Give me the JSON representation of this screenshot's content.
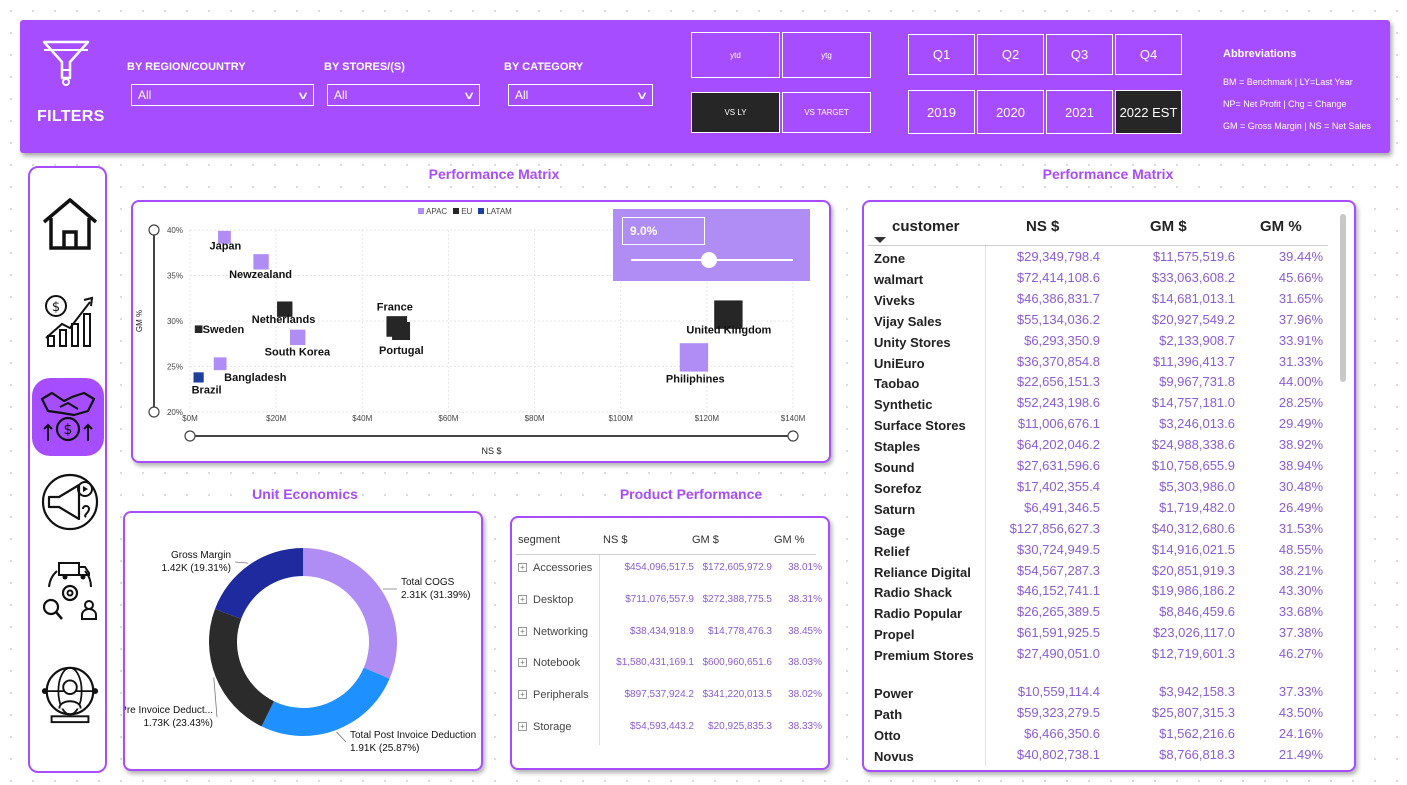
{
  "filters": {
    "title": "FILTERS",
    "dropdowns": [
      {
        "label": "BY REGION/COUNTRY",
        "value": "All"
      },
      {
        "label": "BY STORES/(S)",
        "value": "All"
      },
      {
        "label": "BY CATEGORY",
        "value": "All"
      }
    ],
    "period_buttons": [
      "ytd",
      "ytg",
      "VS LY",
      "VS TARGET"
    ],
    "quarters": [
      "Q1",
      "Q2",
      "Q3",
      "Q4"
    ],
    "years": [
      "2019",
      "2020",
      "2021",
      "2022 EST"
    ],
    "abbreviations": {
      "title": "Abbreviations",
      "lines": [
        "BM = Benchmark | LY=Last Year",
        "NP= Net Profit | Chg = Change",
        "GM = Gross Margin | NS = Net Sales"
      ]
    }
  },
  "sidebar": {
    "items": [
      {
        "icon": "home-icon"
      },
      {
        "icon": "finance-growth-icon"
      },
      {
        "icon": "handshake-money-icon",
        "active": true
      },
      {
        "icon": "marketing-megaphone-icon"
      },
      {
        "icon": "supply-chain-truck-icon"
      },
      {
        "icon": "global-person-icon"
      }
    ]
  },
  "performance_scatter": {
    "title": "Performance Matrix",
    "legend": [
      "APAC",
      "EU",
      "LATAM"
    ],
    "slider_value": "9.0%",
    "slider_fraction": 0.12,
    "colors": {
      "APAC": "#b08cf5",
      "EU": "#262626",
      "LATAM": "#1f3f9e"
    }
  },
  "chart_data": [
    {
      "type": "scatter",
      "title": "Performance Matrix",
      "xlabel": "NS $",
      "ylabel": "GM %",
      "xlim": [
        0,
        140
      ],
      "ylim": [
        20,
        40
      ],
      "x_ticks": [
        "$0M",
        "$20M",
        "$40M",
        "$60M",
        "$80M",
        "$100M",
        "$120M",
        "$140M"
      ],
      "y_ticks": [
        "40%",
        "35%",
        "30%",
        "25%",
        "20%"
      ],
      "legend": "top-center",
      "grid": true,
      "series": [
        {
          "name": "APAC",
          "points": [
            {
              "label": "Japan",
              "x": 8,
              "y": 39.2,
              "size": 3
            },
            {
              "label": "Newzealand",
              "x": 16.5,
              "y": 36.5,
              "size": 4
            },
            {
              "label": "South Korea",
              "x": 25,
              "y": 28.2,
              "size": 4
            },
            {
              "label": "Bangladesh",
              "x": 7,
              "y": 25.3,
              "size": 3
            },
            {
              "label": "Philiphines",
              "x": 117,
              "y": 26.0,
              "size": 9
            }
          ]
        },
        {
          "name": "EU",
          "points": [
            {
              "label": "Netherlands",
              "x": 22,
              "y": 31.3,
              "size": 4
            },
            {
              "label": "Sweden",
              "x": 2,
              "y": 29.1,
              "size": 1
            },
            {
              "label": "France",
              "x": 48,
              "y": 29.4,
              "size": 6
            },
            {
              "label": "Portugal",
              "x": 49,
              "y": 28.9,
              "size": 5
            },
            {
              "label": "United Kingdom",
              "x": 125,
              "y": 30.7,
              "size": 9
            }
          ]
        },
        {
          "name": "LATAM",
          "points": [
            {
              "label": "Brazil",
              "x": 2,
              "y": 23.8,
              "size": 2
            }
          ]
        }
      ]
    },
    {
      "type": "pie",
      "title": "Unit Economics",
      "slices": [
        {
          "name": "Total COGS",
          "value": 2.31,
          "unit": "K",
          "percent": 31.39,
          "label": "Total COGS",
          "text": "2.31K (31.39%)"
        },
        {
          "name": "Total Post Invoice Deduction",
          "value": 1.91,
          "unit": "K",
          "percent": 25.87,
          "label": "Total Post Invoice Deduction",
          "text": "1.91K (25.87%)"
        },
        {
          "name": "Pre Invoice Deduct...",
          "value": 1.73,
          "unit": "K",
          "percent": 23.43,
          "label": "Pre Invoice Deduct...",
          "text": "1.73K (23.43%)"
        },
        {
          "name": "Gross Margin",
          "value": 1.42,
          "unit": "K",
          "percent": 19.31,
          "label": "Gross Margin",
          "text": "1.42K (19.31%)"
        }
      ],
      "colors": [
        "#b08cf5",
        "#1e90ff",
        "#2b2b2b",
        "#1f2a9e"
      ]
    }
  ],
  "unit_economics": {
    "title": "Unit Economics"
  },
  "product_performance": {
    "title": "Product Performance",
    "headers": [
      "segment",
      "NS $",
      "GM $",
      "GM %"
    ],
    "rows": [
      [
        "Accessories",
        "$454,096,517.5",
        "$172,605,972.9",
        "38.01%"
      ],
      [
        "Desktop",
        "$711,076,557.9",
        "$272,388,775.5",
        "38.31%"
      ],
      [
        "Networking",
        "$38,434,918.9",
        "$14,778,476.3",
        "38.45%"
      ],
      [
        "Notebook",
        "$1,580,431,169.1",
        "$600,960,651.6",
        "38.03%"
      ],
      [
        "Peripherals",
        "$897,537,924.2",
        "$341,220,013.5",
        "38.02%"
      ],
      [
        "Storage",
        "$54,593,443.2",
        "$20,925,835.3",
        "38.33%"
      ]
    ]
  },
  "customer_table": {
    "title": "Performance Matrix",
    "headers": [
      "customer",
      "NS $",
      "GM $",
      "GM %"
    ],
    "rows": [
      [
        "Zone",
        "$29,349,798.4",
        "$11,575,519.6",
        "39.44%"
      ],
      [
        "walmart",
        "$72,414,108.6",
        "$33,063,608.2",
        "45.66%"
      ],
      [
        "Viveks",
        "$46,386,831.7",
        "$14,681,013.1",
        "31.65%"
      ],
      [
        "Vijay Sales",
        "$55,134,036.2",
        "$20,927,549.2",
        "37.96%"
      ],
      [
        "Unity Stores",
        "$6,293,350.9",
        "$2,133,908.7",
        "33.91%"
      ],
      [
        "UniEuro",
        "$36,370,854.8",
        "$11,396,413.7",
        "31.33%"
      ],
      [
        "Taobao",
        "$22,656,151.3",
        "$9,967,731.8",
        "44.00%"
      ],
      [
        "Synthetic",
        "$52,243,198.6",
        "$14,757,181.0",
        "28.25%"
      ],
      [
        "Surface Stores",
        "$11,006,676.1",
        "$3,246,013.6",
        "29.49%"
      ],
      [
        "Staples",
        "$64,202,046.2",
        "$24,988,338.6",
        "38.92%"
      ],
      [
        "Sound",
        "$27,631,596.6",
        "$10,758,655.9",
        "38.94%"
      ],
      [
        "Sorefoz",
        "$17,402,355.4",
        "$5,303,986.0",
        "30.48%"
      ],
      [
        "Saturn",
        "$6,491,346.5",
        "$1,719,482.0",
        "26.49%"
      ],
      [
        "Sage",
        "$127,856,627.3",
        "$40,312,680.6",
        "31.53%"
      ],
      [
        "Relief",
        "$30,724,949.5",
        "$14,916,021.5",
        "48.55%"
      ],
      [
        "Reliance Digital",
        "$54,567,287.3",
        "$20,851,919.3",
        "38.21%"
      ],
      [
        "Radio Shack",
        "$46,152,741.1",
        "$19,986,186.2",
        "43.30%"
      ],
      [
        "Radio Popular",
        "$26,265,389.5",
        "$8,846,459.6",
        "33.68%"
      ],
      [
        "Propel",
        "$61,591,925.5",
        "$23,026,117.0",
        "37.38%"
      ],
      [
        "Premium Stores",
        "$27,490,051.0",
        "$12,719,601.3",
        "46.27%"
      ],
      [
        "Power",
        "$10,559,114.4",
        "$3,942,158.3",
        "37.33%"
      ],
      [
        "Path",
        "$59,323,279.5",
        "$25,807,315.3",
        "43.50%"
      ],
      [
        "Otto",
        "$6,466,350.6",
        "$1,562,216.6",
        "24.16%"
      ],
      [
        "Novus",
        "$40,802,738.1",
        "$8,766,818.3",
        "21.49%"
      ]
    ]
  }
}
